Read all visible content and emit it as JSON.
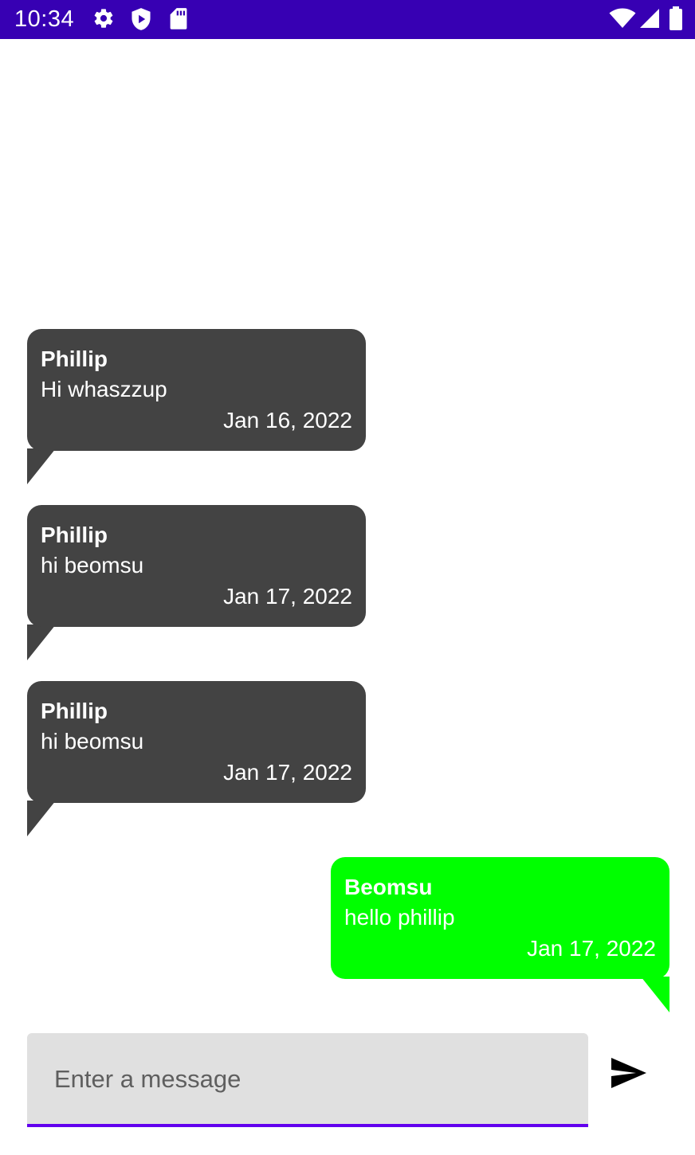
{
  "status_bar": {
    "time": "10:34",
    "icons": [
      "gear-icon",
      "shield-play-icon",
      "sd-card-icon",
      "wifi-icon",
      "signal-icon",
      "battery-icon"
    ],
    "background": "#3700b3"
  },
  "messages": [
    {
      "sender": "Phillip",
      "text": "Hi whaszzup",
      "date": "Jan 16, 2022",
      "direction": "incoming",
      "color": "#434343"
    },
    {
      "sender": "Phillip",
      "text": "hi beomsu",
      "date": "Jan 17, 2022",
      "direction": "incoming",
      "color": "#434343"
    },
    {
      "sender": "Phillip",
      "text": "hi beomsu",
      "date": "Jan 17, 2022",
      "direction": "incoming",
      "color": "#434343"
    },
    {
      "sender": "Beomsu",
      "text": "hello phillip",
      "date": "Jan 17, 2022",
      "direction": "outgoing",
      "color": "#00ff00"
    }
  ],
  "composer": {
    "placeholder": "Enter a message",
    "value": "",
    "underline_color": "#6200ee",
    "send_icon": "send-icon"
  }
}
